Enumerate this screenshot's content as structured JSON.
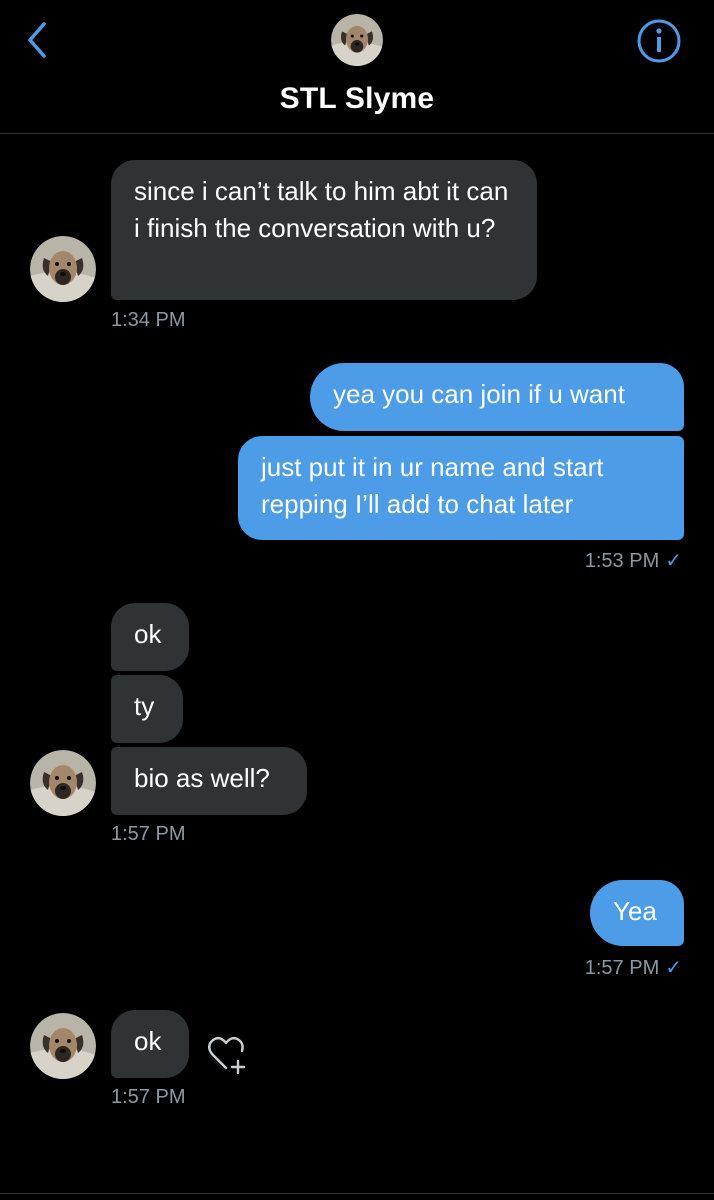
{
  "header": {
    "title": "STL Slyme",
    "back_icon": "chevron-left-icon",
    "info_icon": "info-circle-icon",
    "accent": "#4c9ce8"
  },
  "messages": [
    {
      "side": "in",
      "text": "since i can’t talk to him abt it can i finish the conversation with u?",
      "time": "1:34 PM"
    },
    {
      "side": "out",
      "text": "yea you can join if u want"
    },
    {
      "side": "out",
      "text": "just put it in ur name and start repping I’ll add to chat later",
      "time": "1:53 PM"
    },
    {
      "side": "in",
      "text": "ok"
    },
    {
      "side": "in",
      "text": "ty"
    },
    {
      "side": "in",
      "text": "bio as well?",
      "time": "1:57 PM"
    },
    {
      "side": "out",
      "text": "Yea",
      "time": "1:57 PM"
    },
    {
      "side": "in",
      "text": "ok",
      "time": "1:57 PM"
    }
  ],
  "read_check": "✓",
  "reaction_icon": "heart-plus-icon",
  "colors": {
    "incoming_bubble": "#2f3336",
    "outgoing_bubble": "#4c9ce8",
    "timestamp": "#8b98a5",
    "background": "#000000"
  }
}
